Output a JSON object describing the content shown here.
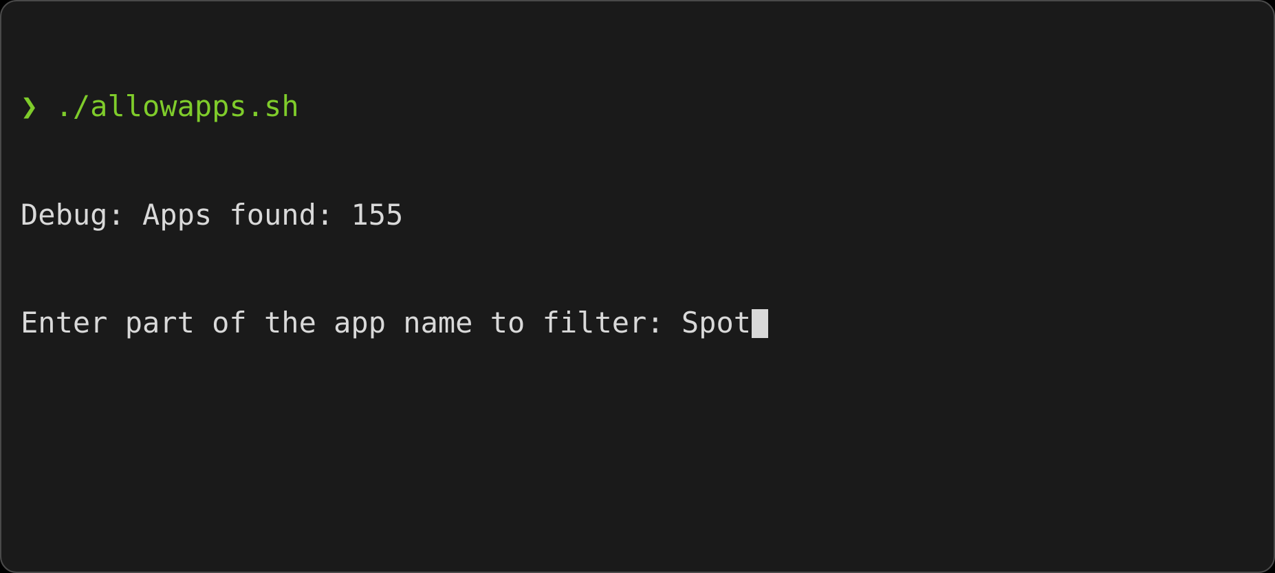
{
  "terminal": {
    "prompt_symbol": "❯",
    "command": "./allowapps.sh",
    "lines": {
      "debug_label": "Debug: Apps found: ",
      "debug_count": "155",
      "input_prompt": "Enter part of the app name to filter: ",
      "user_typed": "Spot"
    }
  },
  "colors": {
    "terminal_bg": "#1a1a1a",
    "terminal_border": "#4a4a4a",
    "prompt_green": "#7fcc2b",
    "text_default": "#d9d9d9"
  }
}
